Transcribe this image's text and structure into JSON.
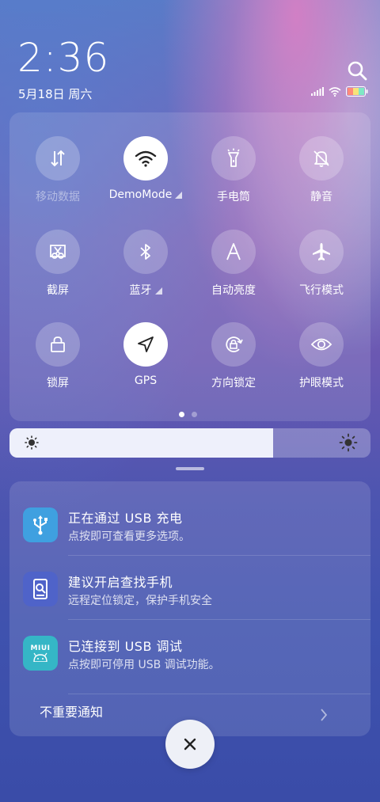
{
  "header": {
    "time": "2:36",
    "date": "5月18日 周六"
  },
  "quick_settings": {
    "tiles": [
      {
        "label": "移动数据",
        "icon": "mobile-data-icon",
        "state": "off-dim"
      },
      {
        "label": "DemoMode",
        "icon": "wifi-icon",
        "state": "on",
        "expandable": true
      },
      {
        "label": "手电筒",
        "icon": "flashlight-icon",
        "state": "off"
      },
      {
        "label": "静音",
        "icon": "mute-bell-icon",
        "state": "off"
      },
      {
        "label": "截屏",
        "icon": "screenshot-icon",
        "state": "off"
      },
      {
        "label": "蓝牙",
        "icon": "bluetooth-icon",
        "state": "off",
        "expandable": true
      },
      {
        "label": "自动亮度",
        "icon": "auto-brightness-icon",
        "state": "off"
      },
      {
        "label": "飞行模式",
        "icon": "airplane-icon",
        "state": "off"
      },
      {
        "label": "锁屏",
        "icon": "lock-icon",
        "state": "off"
      },
      {
        "label": "GPS",
        "icon": "location-arrow-icon",
        "state": "on"
      },
      {
        "label": "方向锁定",
        "icon": "rotation-lock-icon",
        "state": "off"
      },
      {
        "label": "护眼模式",
        "icon": "eye-icon",
        "state": "off"
      }
    ],
    "page_count": 2,
    "current_page": 1
  },
  "brightness": {
    "level": 0.73
  },
  "notifications": [
    {
      "title": "正在通过 USB 充电",
      "subtitle": "点按即可查看更多选项。",
      "icon": "usb-icon",
      "color": "#3fa0e0"
    },
    {
      "title": "建议开启查找手机",
      "subtitle": "远程定位锁定，保护手机安全",
      "icon": "find-phone-icon",
      "color": "#4f63c9"
    },
    {
      "title": "已连接到 USB 调试",
      "subtitle": "点按即可停用 USB 调试功能。",
      "icon": "miui-icon",
      "icon_text": "MIUI",
      "color": "#35b6c6"
    }
  ],
  "unimportant_label": "不重要通知",
  "colors": {
    "accent_on": "#ffffff",
    "panel": "rgba(255,255,255,0.12)"
  }
}
